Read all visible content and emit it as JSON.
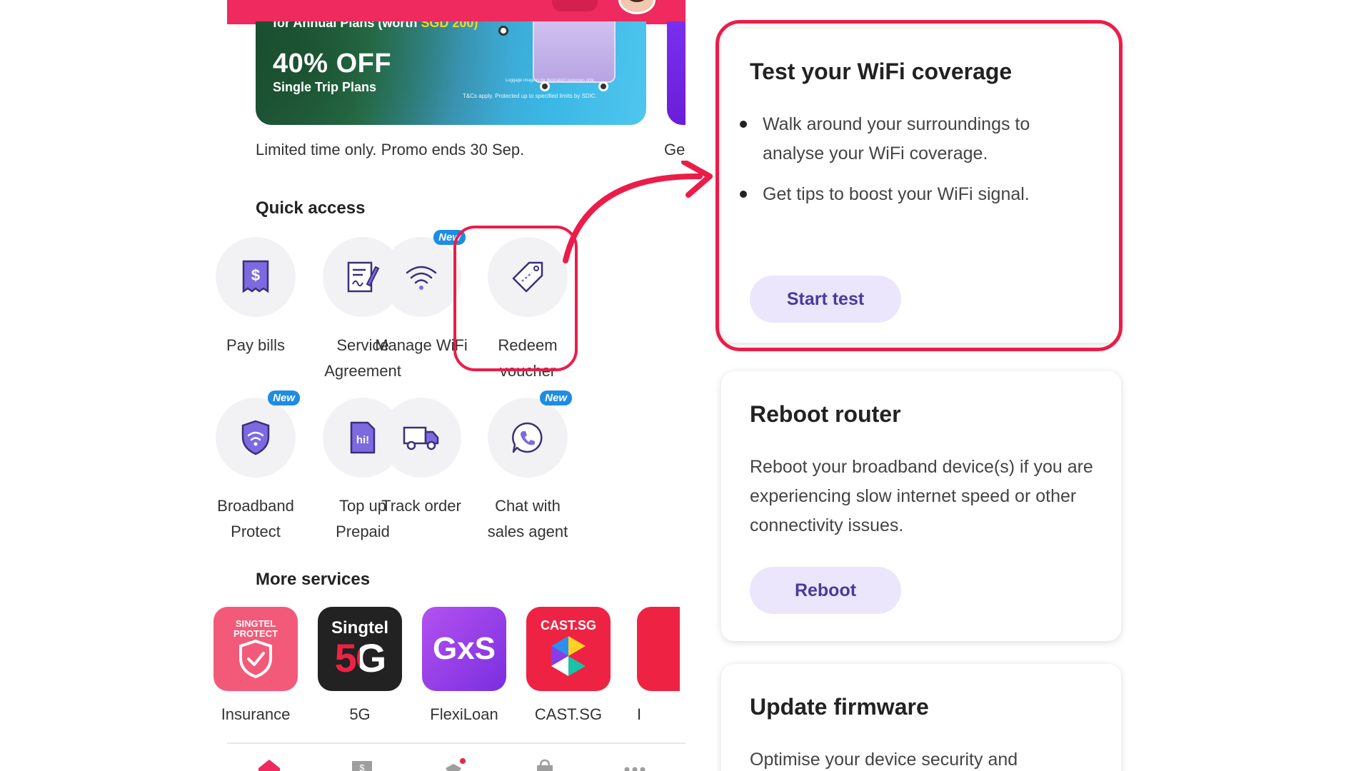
{
  "banner": {
    "top_text": "for Annual Plans (worth",
    "top_highlight": "SGD 200)",
    "discount": "40% OFF",
    "subtitle": "Single Trip Plans",
    "fine_print": "T&Cs apply. Protected up to specified limits by SDIC.",
    "image_note": "Luggage image is for illustration purposes only."
  },
  "promo_text": "Limited time only. Promo ends 30 Sep.",
  "promo_text_2": "Ge",
  "quick_access": {
    "title": "Quick access",
    "new_badge": "New",
    "items": [
      {
        "label": "Pay bills",
        "icon": "bill-icon"
      },
      {
        "label": "Service Agreement",
        "icon": "document-sign-icon"
      },
      {
        "label": "Manage WiFi",
        "icon": "wifi-icon",
        "new": true
      },
      {
        "label": "Redeem voucher",
        "icon": "voucher-tag-icon"
      },
      {
        "label": "Broadband Protect",
        "icon": "wifi-shield-icon",
        "new": true
      },
      {
        "label": "Top up Prepaid",
        "icon": "sim-card-icon"
      },
      {
        "label": "Track order",
        "icon": "delivery-truck-icon"
      },
      {
        "label": "Chat with sales agent",
        "icon": "phone-chat-icon",
        "new": true
      }
    ]
  },
  "more_services": {
    "title": "More services",
    "items": [
      {
        "label": "Insurance",
        "logo_top": "SINGTEL",
        "logo_bottom": "PROTECT",
        "color": "#f35a79"
      },
      {
        "label": "5G",
        "logo_top": "Singtel",
        "logo_bottom": "5G",
        "color": "#222222"
      },
      {
        "label": "FlexiLoan",
        "logo_top": "GxS",
        "color": "#9a3ee8"
      },
      {
        "label": "CAST.SG",
        "logo_top": "CAST.SG",
        "color": "#ee2343"
      },
      {
        "label": "I",
        "color": "#ee2343"
      }
    ]
  },
  "cards": {
    "wifi_test": {
      "title": "Test your WiFi coverage",
      "bullets": [
        "Walk around your surroundings to analyse your WiFi coverage.",
        "Get tips to boost your WiFi signal."
      ],
      "button": "Start test"
    },
    "reboot": {
      "title": "Reboot router",
      "text": "Reboot your broadband device(s) if you are experiencing slow internet speed or other connectivity issues.",
      "button": "Reboot"
    },
    "firmware": {
      "title": "Update firmware",
      "text": "Optimise your device security and"
    }
  },
  "colors": {
    "brand_red": "#ee2a5e",
    "highlight_red": "#ec1c48",
    "accent_purple": "#4b3a9e",
    "button_bg": "#ebe6fb",
    "badge_blue": "#1e8ce3"
  }
}
